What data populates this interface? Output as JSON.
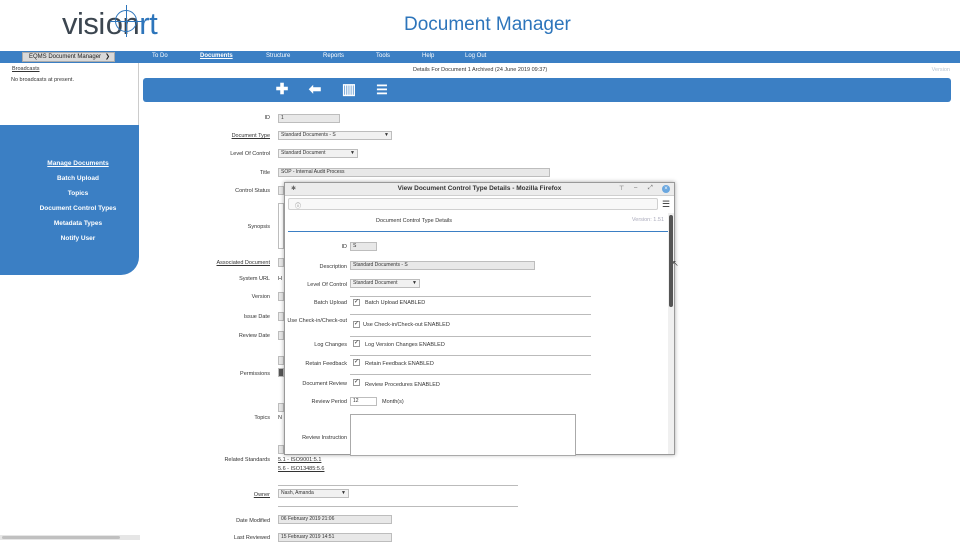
{
  "header": {
    "logo_vision": "visi",
    "logo_on": "on",
    "logo_rt": "rt",
    "app_title": "Document Manager"
  },
  "navbar": {
    "selector_value": "EQMS Document Manager",
    "items": [
      {
        "label": "To Do"
      },
      {
        "label": "Documents"
      },
      {
        "label": "Structure"
      },
      {
        "label": "Reports"
      },
      {
        "label": "Tools"
      },
      {
        "label": "Help"
      },
      {
        "label": "Log Out"
      }
    ]
  },
  "sidebar": {
    "broadcasts_link": "Broadcasts",
    "no_broadcasts": "No broadcasts at present.",
    "menu": [
      {
        "label": "Manage Documents"
      },
      {
        "label": "Batch Upload"
      },
      {
        "label": "Topics"
      },
      {
        "label": "Document Control Types"
      },
      {
        "label": "Metadata Types"
      },
      {
        "label": "Notify User"
      }
    ]
  },
  "page": {
    "details_line": "Details For Document 1 Archived (24 June 2019 09:37)",
    "version_label": "Version",
    "toolbar_icons": [
      "add-icon",
      "back-arrow-icon",
      "chart-icon",
      "list-history-icon"
    ],
    "toolbar_glyphs": {
      "add": "✚",
      "back": "⬅",
      "chart": "▥",
      "history": "☰"
    }
  },
  "form": {
    "id_label": "ID",
    "id_value": "1",
    "doc_type_label": "Document Type",
    "doc_type_value": "Standard Documents - S",
    "level_label": "Level Of Control",
    "level_value": "Standard Document",
    "title_label": "Title",
    "title_value": "SOP - Internal Audit Process",
    "control_status_label": "Control Status",
    "synopsis_label": "Synopsis",
    "associated_label": "Associated Document",
    "system_url_label": "System URL",
    "system_url_partial": "H",
    "version_label": "Version",
    "issue_date_label": "Issue Date",
    "review_date_label": "Review Date",
    "permissions_label": "Permissions",
    "topics_label": "Topics",
    "topics_partial": "N",
    "related_label": "Related Standards",
    "related_links": [
      "5.1 - ISO9001:5.1",
      "5.6 - ISO13485:5.6"
    ],
    "owner_label": "Owner",
    "owner_value": "Nash, Amanda",
    "date_modified_label": "Date Modified",
    "date_modified_value": "06 February 2019 21:06",
    "last_reviewed_label": "Last Reviewed",
    "last_reviewed_value": "15 February 2019 14:51"
  },
  "popup": {
    "title": "View Document Control Type Details - Mozilla Firefox",
    "heading": "Document Control Type Details",
    "version": "Version: 1.51",
    "id_label": "ID",
    "id_value": "S",
    "desc_label": "Description",
    "desc_value": "Standard Documents - S",
    "level_label": "Level Of Control",
    "level_value": "Standard Document",
    "rows": [
      {
        "label": "Batch Upload",
        "text": "Batch Upload ENABLED"
      },
      {
        "label": "Use Check-in/Check-out",
        "text": "Use Check-in/Check-out ENABLED"
      },
      {
        "label": "Log Changes",
        "text": "Log Version Changes ENABLED"
      },
      {
        "label": "Retain Feedback",
        "text": "Retain Feedback ENABLED"
      },
      {
        "label": "Document Review",
        "text": "Review Procedures ENABLED"
      }
    ],
    "review_period_label": "Review Period",
    "review_period_value": "12",
    "review_period_unit": "Month(s)",
    "review_instruction_label": "Review Instruction",
    "check_glyph": "✓"
  }
}
